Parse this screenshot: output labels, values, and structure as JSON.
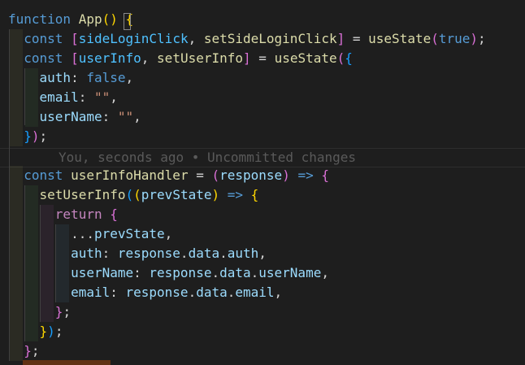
{
  "editor": {
    "lines": [
      {
        "tokens": [
          {
            "t": "function",
            "c": "kw"
          },
          {
            "t": " ",
            "c": "pun"
          },
          {
            "t": "App",
            "c": "fn"
          },
          {
            "t": "() ",
            "c": "br1"
          },
          {
            "t": "{",
            "c": "br1"
          }
        ]
      },
      {
        "tokens": [
          {
            "t": "  const",
            "c": "kw"
          },
          {
            "t": " ",
            "c": "pun"
          },
          {
            "t": "[",
            "c": "br2"
          },
          {
            "t": "sideLoginClick",
            "c": "cst"
          },
          {
            "t": ", ",
            "c": "pun"
          },
          {
            "t": "setSideLoginClick",
            "c": "fn"
          },
          {
            "t": "]",
            "c": "br2"
          },
          {
            "t": " = ",
            "c": "pun"
          },
          {
            "t": "useState",
            "c": "fn"
          },
          {
            "t": "(",
            "c": "br2"
          },
          {
            "t": "true",
            "c": "kw"
          },
          {
            "t": ")",
            "c": "br2"
          },
          {
            "t": ";",
            "c": "pun"
          }
        ]
      },
      {
        "tokens": [
          {
            "t": "  const",
            "c": "kw"
          },
          {
            "t": " ",
            "c": "pun"
          },
          {
            "t": "[",
            "c": "br2"
          },
          {
            "t": "userInfo",
            "c": "cst"
          },
          {
            "t": ", ",
            "c": "pun"
          },
          {
            "t": "setUserInfo",
            "c": "fn"
          },
          {
            "t": "]",
            "c": "br2"
          },
          {
            "t": " = ",
            "c": "pun"
          },
          {
            "t": "useState",
            "c": "fn"
          },
          {
            "t": "(",
            "c": "br2"
          },
          {
            "t": "{",
            "c": "br3"
          }
        ]
      },
      {
        "tokens": [
          {
            "t": "    auth",
            "c": "var"
          },
          {
            "t": ": ",
            "c": "pun"
          },
          {
            "t": "false",
            "c": "kw"
          },
          {
            "t": ",",
            "c": "pun"
          }
        ]
      },
      {
        "tokens": [
          {
            "t": "    email",
            "c": "var"
          },
          {
            "t": ": ",
            "c": "pun"
          },
          {
            "t": "\"\"",
            "c": "str"
          },
          {
            "t": ",",
            "c": "pun"
          }
        ]
      },
      {
        "tokens": [
          {
            "t": "    userName",
            "c": "var"
          },
          {
            "t": ": ",
            "c": "pun"
          },
          {
            "t": "\"\"",
            "c": "str"
          },
          {
            "t": ",",
            "c": "pun"
          }
        ]
      },
      {
        "tokens": [
          {
            "t": "  ",
            "c": "pun"
          },
          {
            "t": "}",
            "c": "br3"
          },
          {
            "t": ")",
            "c": "br2"
          },
          {
            "t": ";",
            "c": "pun"
          }
        ]
      },
      {
        "tokens": []
      },
      {
        "tokens": [
          {
            "t": "  const",
            "c": "kw"
          },
          {
            "t": " ",
            "c": "pun"
          },
          {
            "t": "userInfoHandler",
            "c": "fn"
          },
          {
            "t": " = ",
            "c": "pun"
          },
          {
            "t": "(",
            "c": "br2"
          },
          {
            "t": "response",
            "c": "var"
          },
          {
            "t": ")",
            "c": "br2"
          },
          {
            "t": " ",
            "c": "pun"
          },
          {
            "t": "=>",
            "c": "kw"
          },
          {
            "t": " ",
            "c": "pun"
          },
          {
            "t": "{",
            "c": "br2"
          }
        ]
      },
      {
        "tokens": [
          {
            "t": "    setUserInfo",
            "c": "fn"
          },
          {
            "t": "(",
            "c": "br3"
          },
          {
            "t": "(",
            "c": "br1"
          },
          {
            "t": "prevState",
            "c": "var"
          },
          {
            "t": ")",
            "c": "br1"
          },
          {
            "t": " ",
            "c": "pun"
          },
          {
            "t": "=>",
            "c": "kw"
          },
          {
            "t": " ",
            "c": "pun"
          },
          {
            "t": "{",
            "c": "br1"
          }
        ]
      },
      {
        "tokens": [
          {
            "t": "      return",
            "c": "ctl"
          },
          {
            "t": " ",
            "c": "pun"
          },
          {
            "t": "{",
            "c": "br2"
          }
        ]
      },
      {
        "tokens": [
          {
            "t": "        ...",
            "c": "pun"
          },
          {
            "t": "prevState",
            "c": "var"
          },
          {
            "t": ",",
            "c": "pun"
          }
        ]
      },
      {
        "tokens": [
          {
            "t": "        auth",
            "c": "var"
          },
          {
            "t": ": ",
            "c": "pun"
          },
          {
            "t": "response",
            "c": "var"
          },
          {
            "t": ".",
            "c": "pun"
          },
          {
            "t": "data",
            "c": "var"
          },
          {
            "t": ".",
            "c": "pun"
          },
          {
            "t": "auth",
            "c": "var"
          },
          {
            "t": ",",
            "c": "pun"
          }
        ]
      },
      {
        "tokens": [
          {
            "t": "        userName",
            "c": "var"
          },
          {
            "t": ": ",
            "c": "pun"
          },
          {
            "t": "response",
            "c": "var"
          },
          {
            "t": ".",
            "c": "pun"
          },
          {
            "t": "data",
            "c": "var"
          },
          {
            "t": ".",
            "c": "pun"
          },
          {
            "t": "userName",
            "c": "var"
          },
          {
            "t": ",",
            "c": "pun"
          }
        ]
      },
      {
        "tokens": [
          {
            "t": "        email",
            "c": "var"
          },
          {
            "t": ": ",
            "c": "pun"
          },
          {
            "t": "response",
            "c": "var"
          },
          {
            "t": ".",
            "c": "pun"
          },
          {
            "t": "data",
            "c": "var"
          },
          {
            "t": ".",
            "c": "pun"
          },
          {
            "t": "email",
            "c": "var"
          },
          {
            "t": ",",
            "c": "pun"
          }
        ]
      },
      {
        "tokens": [
          {
            "t": "      ",
            "c": "pun"
          },
          {
            "t": "}",
            "c": "br2"
          },
          {
            "t": ";",
            "c": "pun"
          }
        ]
      },
      {
        "tokens": [
          {
            "t": "    ",
            "c": "pun"
          },
          {
            "t": "}",
            "c": "br1"
          },
          {
            "t": ")",
            "c": "br3"
          },
          {
            "t": ";",
            "c": "pun"
          }
        ]
      },
      {
        "tokens": [
          {
            "t": "  ",
            "c": "pun"
          },
          {
            "t": "}",
            "c": "br2"
          },
          {
            "t": ";",
            "c": "pun"
          }
        ]
      }
    ],
    "blame": "You, seconds ago • Uncommitted changes"
  },
  "colors": {
    "background": "#1e1e1e",
    "keyword": "#569cd6",
    "function": "#dcdcaa",
    "variable": "#9cdcfe",
    "string": "#ce9178"
  }
}
